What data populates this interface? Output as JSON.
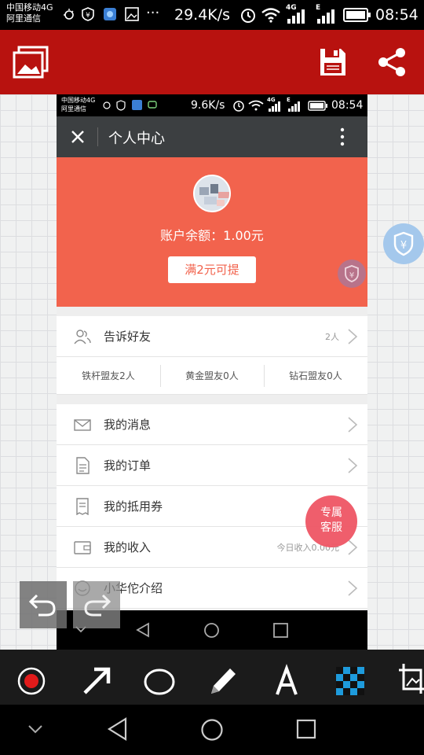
{
  "status_bar": {
    "carrier_line1": "中国移动4G",
    "carrier_line2": "阿里通信",
    "net_speed": "29.4K/s",
    "network_4g": "4G",
    "network_e": "E",
    "time": "08:54"
  },
  "editor_toolbar": {
    "left_icon": "gallery-icon",
    "save_icon": "save-icon",
    "share_icon": "share-icon"
  },
  "inner": {
    "status_bar": {
      "carrier_line1": "中国移动4G",
      "carrier_line2": "阿里通信",
      "net_speed": "9.6K/s",
      "network_4g": "4G",
      "network_e": "E",
      "time": "08:54"
    },
    "title": "个人中心",
    "balance_text": "账户余额：1.00元",
    "withdraw_button": "满2元可提",
    "tell_friends": {
      "label": "告诉好友",
      "value": "2人"
    },
    "tiers": [
      "铁杆盟友2人",
      "黄金盟友0人",
      "钻石盟友0人"
    ],
    "menu": [
      {
        "label": "我的消息",
        "value": "",
        "icon": "mail-icon"
      },
      {
        "label": "我的订单",
        "value": "",
        "icon": "document-icon"
      },
      {
        "label": "我的抵用券",
        "value": "",
        "icon": "receipt-icon"
      },
      {
        "label": "我的收入",
        "value": "今日收入0.00元",
        "icon": "wallet-icon"
      },
      {
        "label": "小华佗介绍",
        "value": "",
        "icon": "smile-icon"
      }
    ],
    "service_button": {
      "line1": "专属",
      "line2": "客服"
    }
  },
  "tools": [
    "record-icon",
    "arrow-icon",
    "ellipse-icon",
    "pencil-icon",
    "text-icon",
    "mosaic-icon",
    "crop-icon"
  ],
  "colors": {
    "toolbar_red": "#b8120f",
    "hero_orange": "#f2634d",
    "service_pink": "#ef5867",
    "mosaic_blue": "#1e9bdc"
  }
}
